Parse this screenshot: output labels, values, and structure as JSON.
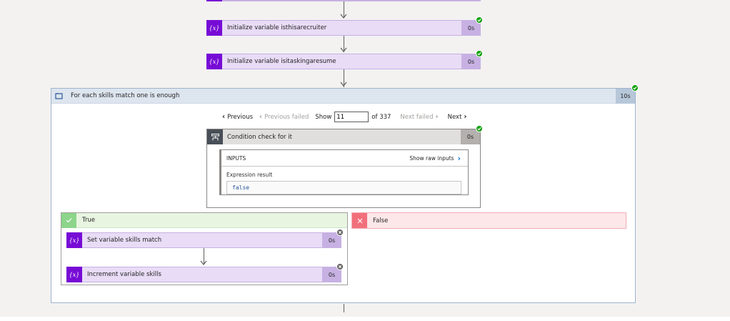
{
  "flow": {
    "steps": [
      {
        "title": "Initialize variable isthisarecruiter",
        "duration": "0s",
        "status": "success"
      },
      {
        "title": "Initialize variable isitaskingaresume",
        "duration": "0s",
        "status": "success"
      }
    ],
    "foreach": {
      "title": "For each skills match one is enough",
      "duration": "10s",
      "status": "success",
      "pager": {
        "previous": "Previous",
        "previous_failed": "Previous failed",
        "show_label": "Show",
        "current": "11",
        "of_total": "of 337",
        "next_failed": "Next failed",
        "next": "Next"
      },
      "condition": {
        "title": "Condition check for it",
        "duration": "0s",
        "status": "success",
        "inputs_label": "INPUTS",
        "show_raw_inputs": "Show raw inputs",
        "expression_label": "Expression result",
        "expression_value": "false"
      },
      "true_branch": {
        "label": "True",
        "actions": [
          {
            "title": "Set variable skills match",
            "duration": "0s",
            "status": "skipped"
          },
          {
            "title": "Increment variable skills",
            "duration": "0s",
            "status": "skipped"
          }
        ]
      },
      "false_branch": {
        "label": "False"
      }
    },
    "icons": {
      "variable": "variable-icon",
      "foreach": "foreach-loop-icon",
      "condition": "condition-icon",
      "true": "checkmark-icon",
      "false": "close-icon"
    },
    "colors": {
      "variable_accent": "#770bd6",
      "variable_bg": "#e8dcf6",
      "success": "#13a10e",
      "skipped": "#605e5c",
      "foreach_header": "#dde5ef",
      "true_bg": "#e8f5e1",
      "false_bg": "#fde7e9"
    }
  }
}
